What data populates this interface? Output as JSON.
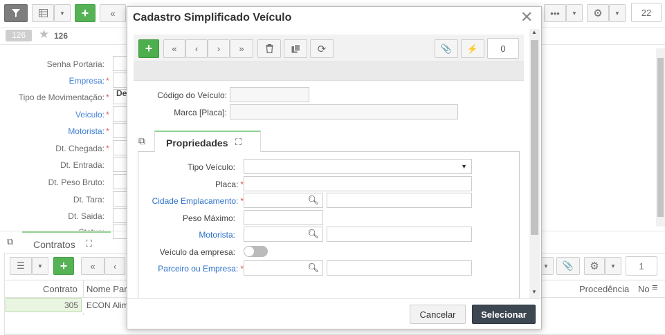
{
  "bg": {
    "filter_icon": "filter-icon",
    "counter_top": "22",
    "badge_count": "126",
    "fav_count": "126",
    "fields": [
      {
        "label": "Senha Portaria:",
        "link": false,
        "req": false
      },
      {
        "label": "Empresa:",
        "link": true,
        "req": true
      },
      {
        "label": "Tipo de Movimentação:",
        "link": false,
        "req": true
      },
      {
        "label": "Veiculo:",
        "link": true,
        "req": true
      },
      {
        "label": "Motorista:",
        "link": true,
        "req": true
      },
      {
        "label": "Dt. Chegada:",
        "link": false,
        "req": true
      },
      {
        "label": "Dt. Entrada:",
        "link": false,
        "req": false
      },
      {
        "label": "Dt. Peso Bruto:",
        "link": false,
        "req": false
      },
      {
        "label": "Dt. Tara:",
        "link": false,
        "req": false
      },
      {
        "label": "Dt. Saida:",
        "link": false,
        "req": false
      },
      {
        "label": "Status:",
        "link": false,
        "req": false
      }
    ],
    "tipo_mov_value": "De",
    "contratos_tab": "Contratos",
    "contratos_counter": "1",
    "grid_headers": [
      "Contrato",
      "Nome Par",
      "Procedência",
      "No"
    ],
    "grid_row": {
      "contrato": "305",
      "nome": "ECON Alim"
    }
  },
  "modal": {
    "title": "Cadastro Simplificado Veículo",
    "counter": "0",
    "codigo_label": "Código do Veículo:",
    "marca_label": "Marca [Placa]:",
    "tab_label": "Propriedades",
    "fields": {
      "tipo": "Tipo Veículo:",
      "placa": "Placa:",
      "cidade": "Cidade Emplacamento:",
      "peso": "Peso Máximo:",
      "motorista": "Motorista:",
      "veiculo_empresa": "Veículo da empresa:",
      "parceiro": "Parceiro ou Empresa:"
    },
    "cancel": "Cancelar",
    "select": "Selecionar",
    "required_mark": "*"
  }
}
